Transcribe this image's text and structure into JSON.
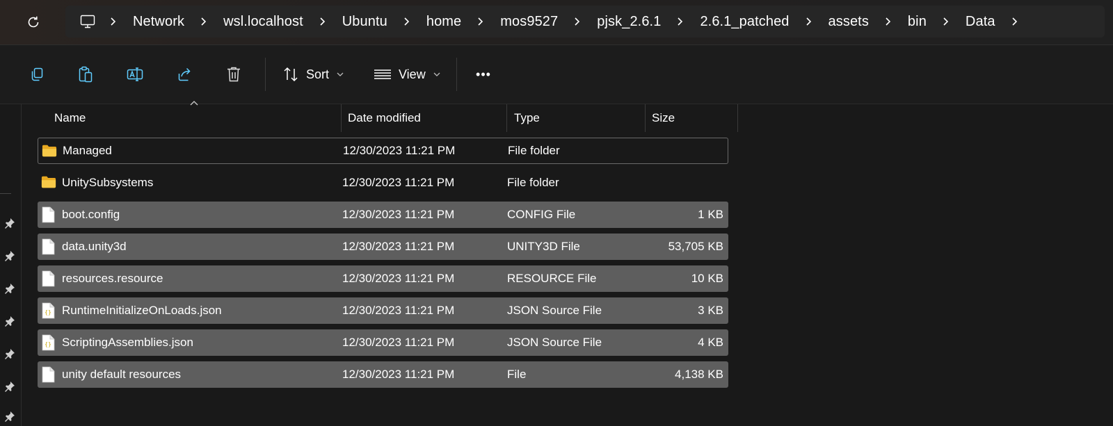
{
  "address_bar": {
    "crumbs": [
      "Network",
      "wsl.localhost",
      "Ubuntu",
      "home",
      "mos9527",
      "pjsk_2.6.1",
      "2.6.1_patched",
      "assets",
      "bin",
      "Data"
    ]
  },
  "toolbar": {
    "sort_label": "Sort",
    "view_label": "View",
    "more_label": "•••"
  },
  "columns": {
    "name": "Name",
    "date": "Date modified",
    "type": "Type",
    "size": "Size"
  },
  "files": [
    {
      "name": "Managed",
      "date": "12/30/2023 11:21 PM",
      "type": "File folder",
      "size": "",
      "icon": "folder-icon"
    },
    {
      "name": "UnitySubsystems",
      "date": "12/30/2023 11:21 PM",
      "type": "File folder",
      "size": "",
      "icon": "folder-icon"
    },
    {
      "name": "boot.config",
      "date": "12/30/2023 11:21 PM",
      "type": "CONFIG File",
      "size": "1 KB",
      "icon": "file-icon"
    },
    {
      "name": "data.unity3d",
      "date": "12/30/2023 11:21 PM",
      "type": "UNITY3D File",
      "size": "53,705 KB",
      "icon": "file-icon"
    },
    {
      "name": "resources.resource",
      "date": "12/30/2023 11:21 PM",
      "type": "RESOURCE File",
      "size": "10 KB",
      "icon": "file-icon"
    },
    {
      "name": "RuntimeInitializeOnLoads.json",
      "date": "12/30/2023 11:21 PM",
      "type": "JSON Source File",
      "size": "3 KB",
      "icon": "json-file-icon"
    },
    {
      "name": "ScriptingAssemblies.json",
      "date": "12/30/2023 11:21 PM",
      "type": "JSON Source File",
      "size": "4 KB",
      "icon": "json-file-icon"
    },
    {
      "name": "unity default resources",
      "date": "12/30/2023 11:21 PM",
      "type": "File",
      "size": "4,138 KB",
      "icon": "file-icon"
    }
  ],
  "colors": {
    "accent": "#60cdff",
    "selected_row": "#5e5e5e",
    "folder": "#f7c948"
  }
}
